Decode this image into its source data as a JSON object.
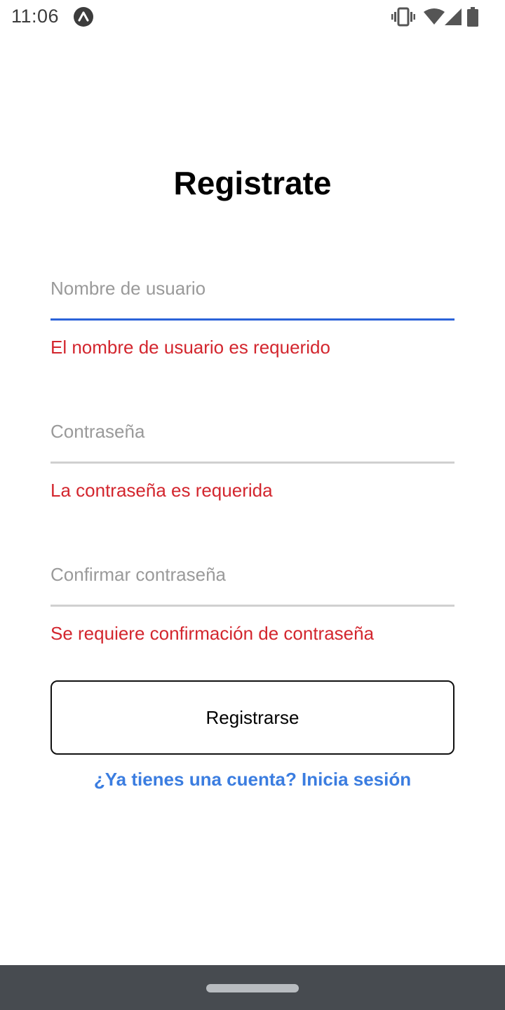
{
  "status_bar": {
    "time": "11:06",
    "icons": [
      "react-native-app-icon",
      "vibrate-icon",
      "wifi-icon",
      "cell-signal-icon",
      "battery-icon"
    ]
  },
  "title": "Registrate",
  "form": {
    "username": {
      "value": "",
      "placeholder": "Nombre de usuario",
      "error": "El nombre de usuario es requerido"
    },
    "password": {
      "value": "",
      "placeholder": "Contraseña",
      "error": "La contraseña es requerida"
    },
    "confirm_password": {
      "value": "",
      "placeholder": "Confirmar contraseña",
      "error": "Se requiere confirmación de contraseña"
    },
    "submit_label": "Registrarse",
    "login_link": "¿Ya tienes una cuenta? Inicia sesión"
  },
  "colors": {
    "focused_underline": "#2b63d9",
    "error": "#d3262e",
    "link": "#3b7de0",
    "nav_bar": "#474b50"
  }
}
